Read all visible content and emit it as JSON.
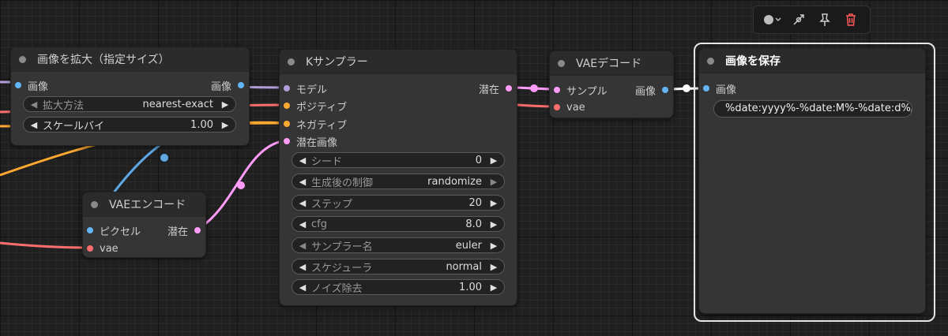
{
  "colors": {
    "image": "#64b5f6",
    "latent": "#ff9cf9",
    "model": "#b39ddb",
    "conditioning": "#ffa931",
    "vae": "#ff6e6e"
  },
  "toolbar": {
    "color_icon": "color-circle-icon",
    "bypass_icon": "bypass-icon",
    "pin_icon": "pin-icon",
    "delete_icon": "trash-icon"
  },
  "upscale_node": {
    "title": "画像を拡大（指定サイズ）",
    "input_image": "画像",
    "output_image": "画像",
    "widgets": [
      {
        "label": "拡大方法",
        "value": "nearest-exact"
      },
      {
        "label": "スケールバイ",
        "value": "1.00"
      }
    ]
  },
  "ksampler_node": {
    "title": "Kサンプラー",
    "inputs": [
      "モデル",
      "ポジティブ",
      "ネガティブ",
      "潜在画像"
    ],
    "output_latent": "潜在",
    "widgets": [
      {
        "label": "シード",
        "value": "0"
      },
      {
        "label": "生成後の制御",
        "value": "randomize"
      },
      {
        "label": "ステップ",
        "value": "20"
      },
      {
        "label": "cfg",
        "value": "8.0"
      },
      {
        "label": "サンプラー名",
        "value": "euler"
      },
      {
        "label": "スケジューラ",
        "value": "normal"
      },
      {
        "label": "ノイズ除去",
        "value": "1.00"
      }
    ]
  },
  "vae_encode_node": {
    "title": "VAEエンコード",
    "input_pixels": "ピクセル",
    "input_vae": "vae",
    "output_latent": "潜在"
  },
  "vae_decode_node": {
    "title": "VAEデコード",
    "input_samples": "サンプル",
    "input_vae": "vae",
    "output_image": "画像"
  },
  "save_image_node": {
    "title": "画像を保存",
    "input_image": "画像",
    "filename_prefix": "%date:yyyy%-%date:M%-%date:d%/"
  }
}
